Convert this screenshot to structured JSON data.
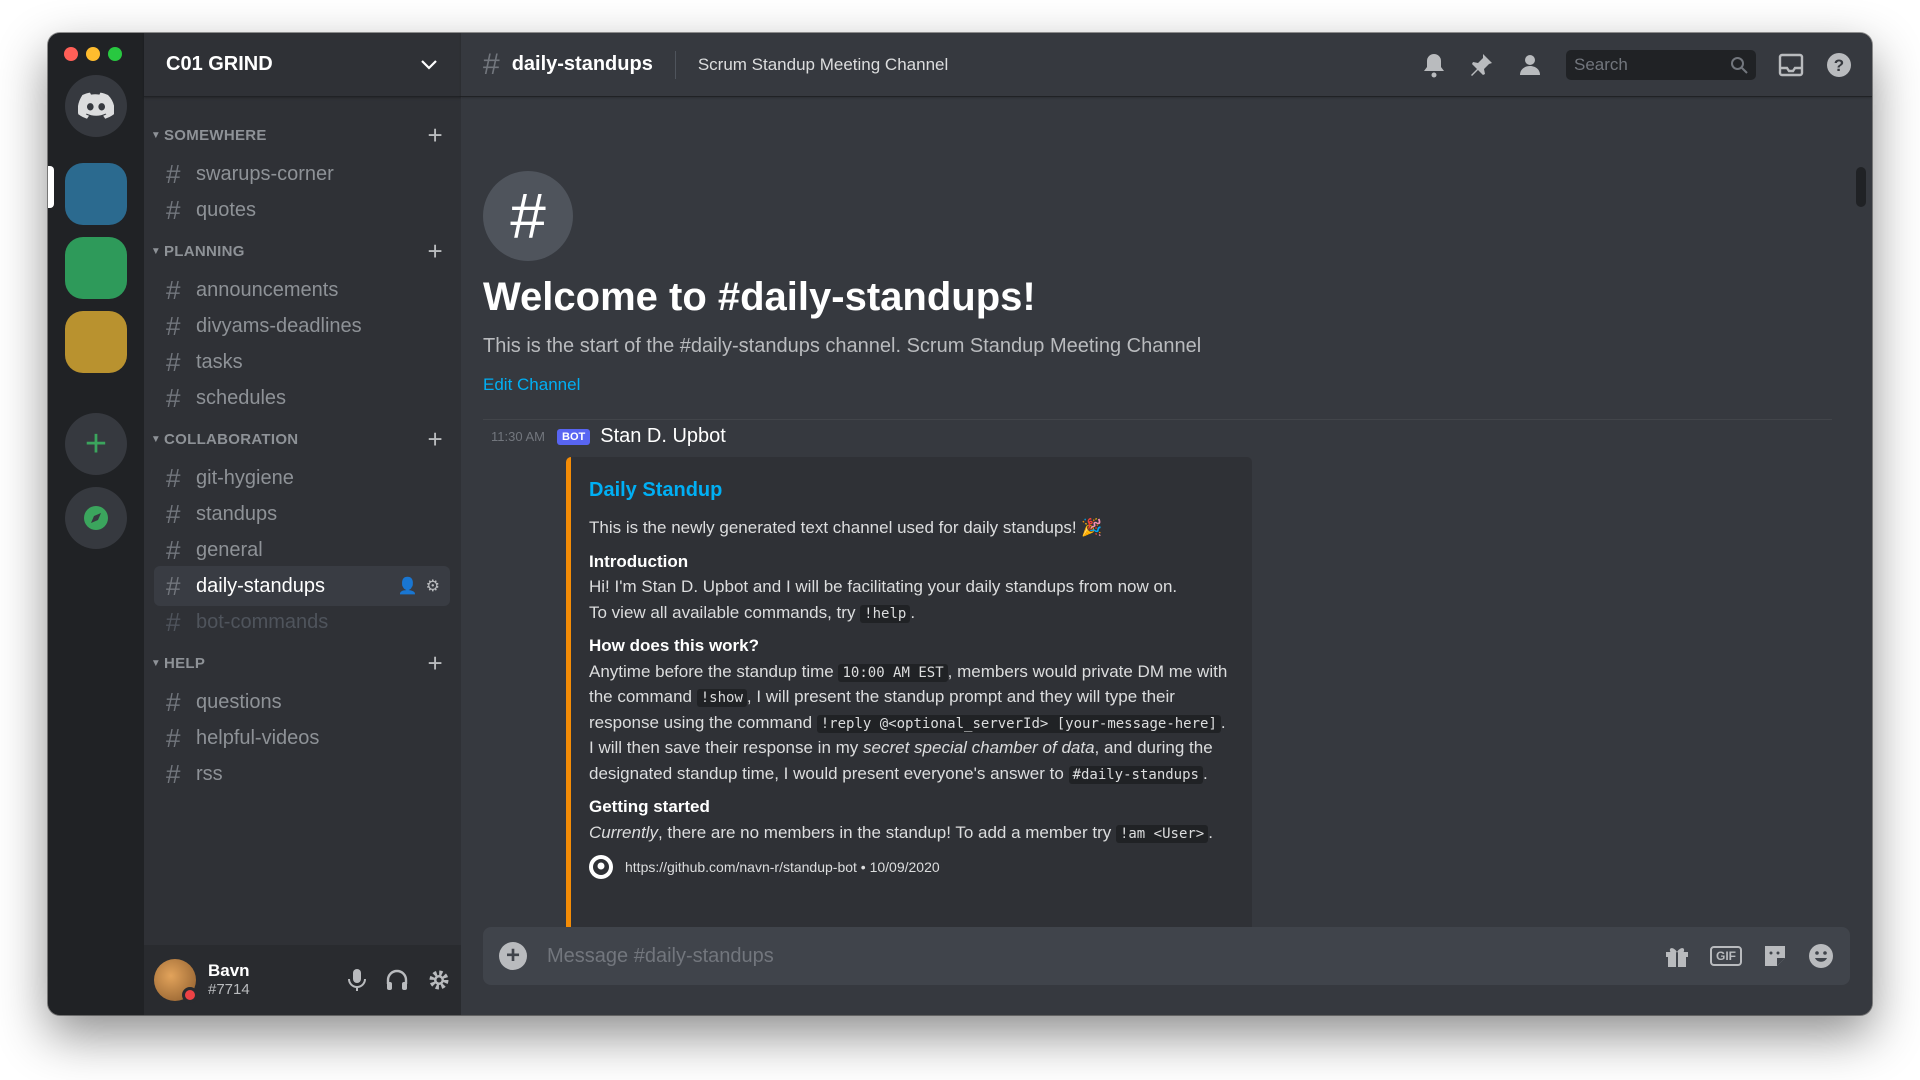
{
  "colors": {
    "accent": "#5865f2",
    "link": "#00aff4",
    "embed_border": "#f48c06",
    "online_red": "#ed4245",
    "green": "#3ba55d"
  },
  "guild": {
    "name": "C01 GRIND"
  },
  "categories": [
    {
      "name": "SOMEWHERE",
      "channels": [
        "swarups-corner",
        "quotes"
      ]
    },
    {
      "name": "PLANNING",
      "channels": [
        "announcements",
        "divyams-deadlines",
        "tasks",
        "schedules"
      ]
    },
    {
      "name": "COLLABORATION",
      "channels": [
        "git-hygiene",
        "standups",
        "general",
        "daily-standups",
        "bot-commands"
      ]
    },
    {
      "name": "HELP",
      "channels": [
        "questions",
        "helpful-videos",
        "rss"
      ]
    }
  ],
  "active_channel": "daily-standups",
  "user": {
    "name": "Bavn",
    "tag": "#7714"
  },
  "topbar": {
    "channel": "daily-standups",
    "topic": "Scrum Standup Meeting Channel",
    "search_placeholder": "Search"
  },
  "welcome": {
    "title": "Welcome to #daily-standups!",
    "subline": "This is the start of the #daily-standups channel. Scrum Standup Meeting Channel",
    "edit_link": "Edit Channel"
  },
  "message": {
    "time": "11:30 AM",
    "badge": "BOT",
    "author": "Stan D. Upbot",
    "embed": {
      "title": "Daily Standup",
      "intro_line": "This is the newly generated text channel used for daily standups! 🎉",
      "f1_name": "Introduction",
      "f1_l1": "Hi! I'm Stan D. Upbot and I will be facilitating your daily standups from now on.",
      "f1_l2a": "To view all available commands, try ",
      "f1_code": "!help",
      "f1_l2b": ".",
      "f2_name": "How does this work?",
      "f2_a": "Anytime before the standup time ",
      "f2_code1": "10:00 AM EST",
      "f2_b": ", members would private DM me with the command ",
      "f2_code2": "!show",
      "f2_c": ", I will present the standup prompt and they will type their response using the command ",
      "f2_code3": "!reply @<optional_serverId> [your-message-here]",
      "f2_d": ". I will then save their response in my ",
      "f2_em": "secret special chamber of data",
      "f2_e": ", and during the designated standup time, I would present everyone's answer to ",
      "f2_code4": "#daily-standups",
      "f2_f": ".",
      "f3_name": "Getting started",
      "f3_em": "Currently",
      "f3_a": ", there are no members in the standup! To add a member try ",
      "f3_code": "!am <User>",
      "f3_b": ".",
      "footer": "https://github.com/navn-r/standup-bot • 10/09/2020"
    }
  },
  "composer": {
    "placeholder": "Message #daily-standups",
    "gif_label": "GIF"
  }
}
